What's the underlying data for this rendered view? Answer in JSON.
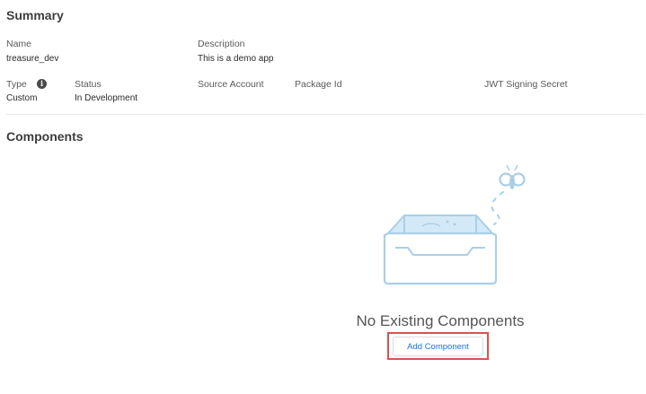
{
  "summary": {
    "title": "Summary",
    "name_label": "Name",
    "name_value": "treasure_dev",
    "description_label": "Description",
    "description_value": "This is a demo app",
    "type_label": "Type",
    "type_value": "Custom",
    "status_label": "Status",
    "status_value": "In Development",
    "source_account_label": "Source Account",
    "package_id_label": "Package Id",
    "jwt_label": "JWT Signing Secret"
  },
  "components": {
    "title": "Components",
    "empty_message": "No Existing Components",
    "add_button_label": "Add Component"
  },
  "icons": {
    "info": "info-icon",
    "illustration": "empty-tray-with-bug-icon"
  },
  "colors": {
    "accent_blue": "#1a73e8",
    "highlight_red": "#d9534f",
    "illustration_blue": "#a9cfe8"
  }
}
